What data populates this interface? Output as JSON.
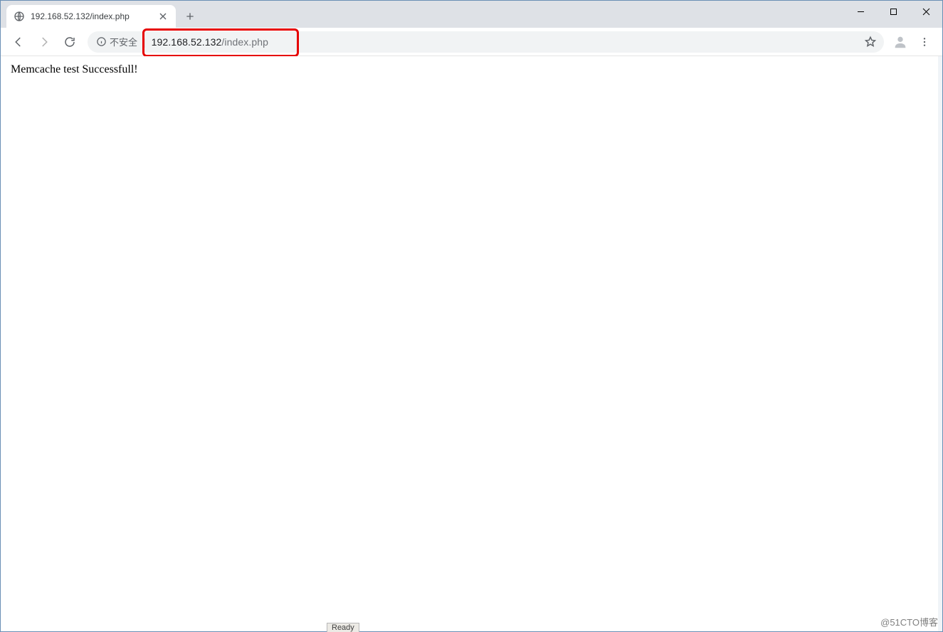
{
  "tab": {
    "title": "192.168.52.132/index.php"
  },
  "omnibox": {
    "insecure_label": "不安全",
    "url_host": "192.168.52.132",
    "url_path": "/index.php"
  },
  "page": {
    "body_text": "Memcache test Successfull!"
  },
  "watermark": "@51CTO博客",
  "status": "Ready"
}
